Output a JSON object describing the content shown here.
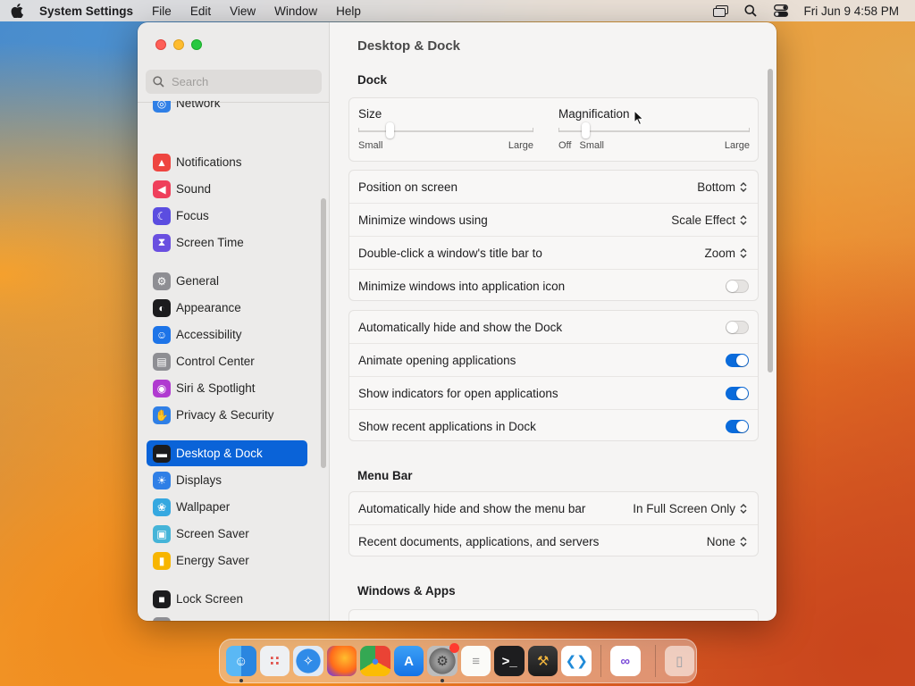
{
  "menubar": {
    "app_name": "System Settings",
    "items": [
      "File",
      "Edit",
      "View",
      "Window",
      "Help"
    ],
    "clock": "Fri Jun 9  4:58 PM"
  },
  "sidebar": {
    "search_placeholder": "Search",
    "items": [
      {
        "label": "Network",
        "icon": "globe-icon",
        "color": "#2f7fe6"
      },
      {
        "label": "Notifications",
        "icon": "bell-icon",
        "color": "#ee4540"
      },
      {
        "label": "Sound",
        "icon": "speaker-icon",
        "color": "#ef3f5b"
      },
      {
        "label": "Focus",
        "icon": "moon-icon",
        "color": "#5b4de0"
      },
      {
        "label": "Screen Time",
        "icon": "hourglass-icon",
        "color": "#6a4fe0"
      },
      {
        "label": "General",
        "icon": "gear-icon",
        "color": "#8e8e93"
      },
      {
        "label": "Appearance",
        "icon": "appearance-icon",
        "color": "#1c1c1e"
      },
      {
        "label": "Accessibility",
        "icon": "accessibility-icon",
        "color": "#1d74e8"
      },
      {
        "label": "Control Center",
        "icon": "control-center-icon",
        "color": "#8e8e93"
      },
      {
        "label": "Siri & Spotlight",
        "icon": "siri-icon",
        "color": "#b03ad0"
      },
      {
        "label": "Privacy & Security",
        "icon": "hand-icon",
        "color": "#2f7fe6"
      },
      {
        "label": "Desktop & Dock",
        "icon": "dock-icon",
        "color": "#1c1c1e"
      },
      {
        "label": "Displays",
        "icon": "sun-icon",
        "color": "#2f7fe6"
      },
      {
        "label": "Wallpaper",
        "icon": "wallpaper-icon",
        "color": "#35a8e0"
      },
      {
        "label": "Screen Saver",
        "icon": "screen-saver-icon",
        "color": "#45b4d8"
      },
      {
        "label": "Energy Saver",
        "icon": "battery-icon",
        "color": "#f7b500"
      },
      {
        "label": "Lock Screen",
        "icon": "lock-screen-icon",
        "color": "#1c1c1e"
      },
      {
        "label": "Login Password",
        "icon": "lock-icon",
        "color": "#8e8e93"
      }
    ],
    "selected": "Desktop & Dock"
  },
  "main": {
    "title": "Desktop & Dock",
    "dock_section": "Dock",
    "size_slider": {
      "label": "Size",
      "min_label": "Small",
      "max_label": "Large",
      "value": 0.18
    },
    "magnification_slider": {
      "label": "Magnification",
      "off_label": "Off",
      "min_label": "Small",
      "max_label": "Large",
      "value": 0.14
    },
    "dock_rows": [
      {
        "label": "Position on screen",
        "value": "Bottom"
      },
      {
        "label": "Minimize windows using",
        "value": "Scale Effect"
      },
      {
        "label": "Double-click a window's title bar to",
        "value": "Zoom"
      }
    ],
    "minimize_into_app_icon": {
      "label": "Minimize windows into application icon",
      "on": false
    },
    "toggles": [
      {
        "label": "Automatically hide and show the Dock",
        "on": false
      },
      {
        "label": "Animate opening applications",
        "on": true
      },
      {
        "label": "Show indicators for open applications",
        "on": true
      },
      {
        "label": "Show recent applications in Dock",
        "on": true
      }
    ],
    "menubar_section": "Menu Bar",
    "menubar_rows": [
      {
        "label": "Automatically hide and show the menu bar",
        "value": "In Full Screen Only"
      },
      {
        "label": "Recent documents, applications, and servers",
        "value": "None"
      }
    ],
    "windows_section": "Windows & Apps"
  },
  "dock": {
    "apps": [
      "finder-icon",
      "launchpad-icon",
      "safari-icon",
      "firefox-icon",
      "chrome-icon",
      "app-store-icon",
      "system-settings-icon",
      "textedit-icon",
      "terminal-icon",
      "instruments-icon",
      "vscode-icon",
      "visual-studio-icon",
      "trash-icon"
    ]
  }
}
